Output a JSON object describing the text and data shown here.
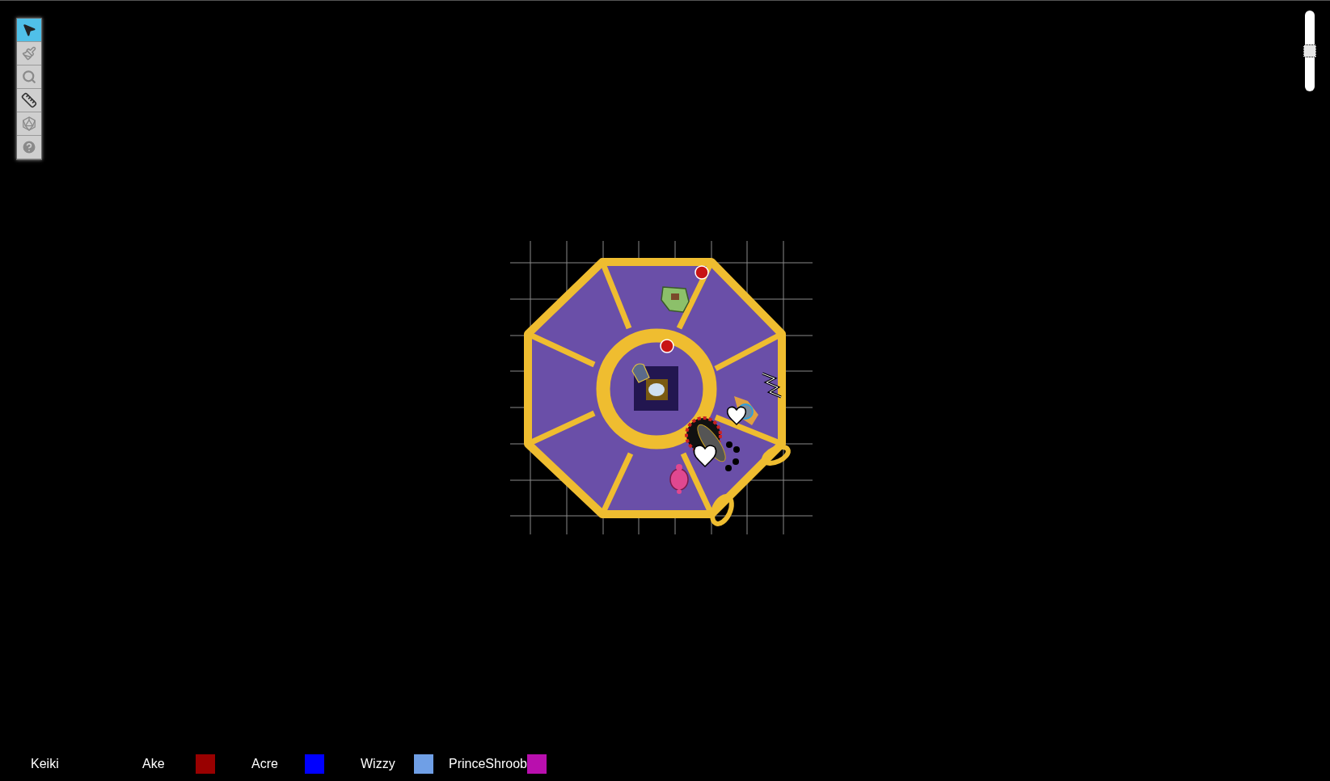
{
  "toolbar": [
    {
      "kind": "select",
      "selected": true
    },
    {
      "kind": "draw",
      "selected": false
    },
    {
      "kind": "zoom",
      "selected": false
    },
    {
      "kind": "measure",
      "selected": false
    },
    {
      "kind": "dice",
      "selected": false
    },
    {
      "kind": "help",
      "selected": false
    }
  ],
  "zoom_slider": {
    "level": 0.5
  },
  "players": [
    {
      "name": "Keiki"
    },
    {
      "name": "Ake",
      "color": "#990000"
    },
    {
      "name": "Acre",
      "color": "#0000ff"
    },
    {
      "name": "Wizzy",
      "color": "#6f9fe6"
    },
    {
      "name": "PrinceShroob",
      "color": "#b90fae"
    }
  ]
}
